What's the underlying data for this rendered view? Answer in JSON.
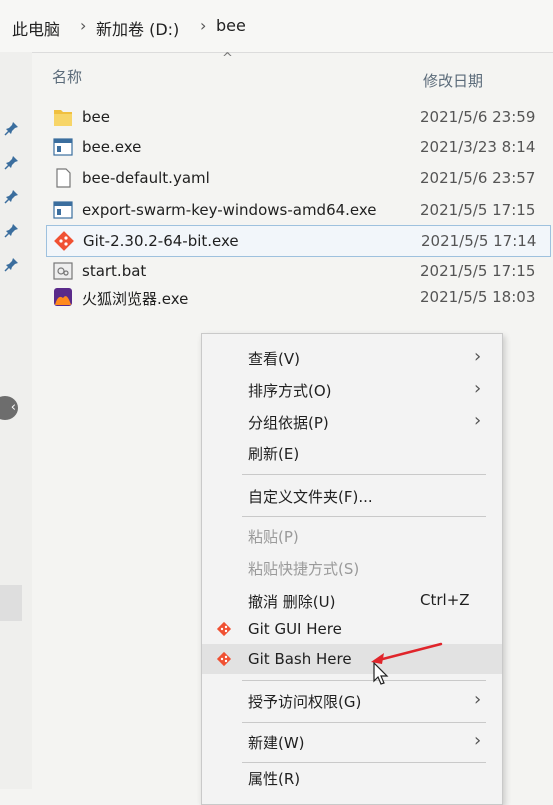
{
  "breadcrumb": {
    "items": [
      "此电脑",
      "新加卷 (D:)",
      "bee"
    ],
    "separator": "›"
  },
  "columns": {
    "name": "名称",
    "modified": "修改日期"
  },
  "files": [
    {
      "name": "bee",
      "date": "2021/5/6 23:59",
      "icon": "folder-icon"
    },
    {
      "name": "bee.exe",
      "date": "2021/3/23 8:14",
      "icon": "exe-icon"
    },
    {
      "name": "bee-default.yaml",
      "date": "2021/5/6 23:57",
      "icon": "document-icon"
    },
    {
      "name": "export-swarm-key-windows-amd64.exe",
      "date": "2021/5/5 17:15",
      "icon": "exe-icon"
    },
    {
      "name": "Git-2.30.2-64-bit.exe",
      "date": "2021/5/5 17:14",
      "icon": "git-icon",
      "selected": true
    },
    {
      "name": "start.bat",
      "date": "2021/5/5 17:15",
      "icon": "batch-file-icon"
    },
    {
      "name": "火狐浏览器.exe",
      "date": "2021/5/5 18:03",
      "icon": "firefox-icon"
    }
  ],
  "context_menu": {
    "items": [
      {
        "label": "查看(V)",
        "submenu": true
      },
      {
        "label": "排序方式(O)",
        "submenu": true
      },
      {
        "label": "分组依据(P)",
        "submenu": true
      },
      {
        "label": "刷新(E)"
      },
      {
        "label": "自定义文件夹(F)..."
      },
      {
        "label": "粘贴(P)",
        "disabled": true
      },
      {
        "label": "粘贴快捷方式(S)",
        "disabled": true
      },
      {
        "label": "撤消 删除(U)",
        "shortcut": "Ctrl+Z"
      },
      {
        "label": "Git GUI Here",
        "icon": "git-icon"
      },
      {
        "label": "Git Bash Here",
        "icon": "git-icon",
        "hover": true
      },
      {
        "label": "授予访问权限(G)",
        "submenu": true
      },
      {
        "label": "新建(W)",
        "submenu": true
      },
      {
        "label": "属性(R)"
      }
    ],
    "submenu_arrow": "›"
  },
  "colors": {
    "selection_border": "#9ec1de",
    "hover_background": "#e2e2e2",
    "annotation_arrow": "#e0252b",
    "folder": "#f0c040",
    "git": "#f05133"
  }
}
